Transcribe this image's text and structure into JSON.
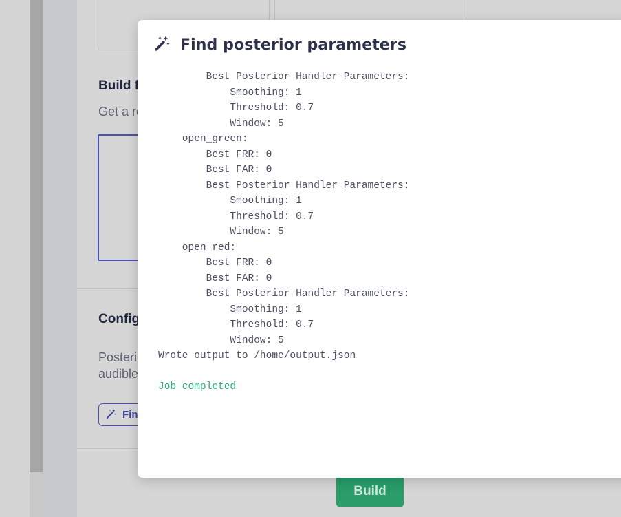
{
  "background": {
    "build_section": {
      "title": "Build f",
      "description": "Get a re"
    },
    "config_section": {
      "title": "Config",
      "description_line1": "Posteri",
      "description_line2": "audible"
    },
    "find_button_label": "Fin",
    "build_button_label": "Build"
  },
  "modal": {
    "title": "Find posterior parameters",
    "icon": "magic-wand-icon",
    "log_lines": [
      "        Best Posterior Handler Parameters:",
      "            Smoothing: 1",
      "            Threshold: 0.7",
      "            Window: 5",
      "    open_green:",
      "        Best FRR: 0",
      "        Best FAR: 0",
      "        Best Posterior Handler Parameters:",
      "            Smoothing: 1",
      "            Threshold: 0.7",
      "            Window: 5",
      "    open_red:",
      "        Best FRR: 0",
      "        Best FAR: 0",
      "        Best Posterior Handler Parameters:",
      "            Smoothing: 1",
      "            Threshold: 0.7",
      "            Window: 5",
      "Wrote output to /home/output.json",
      "",
      "Job completed"
    ]
  },
  "colors": {
    "accent": "#4a52b8",
    "success": "#2bb37a",
    "build_green": "#2a9d6a"
  }
}
